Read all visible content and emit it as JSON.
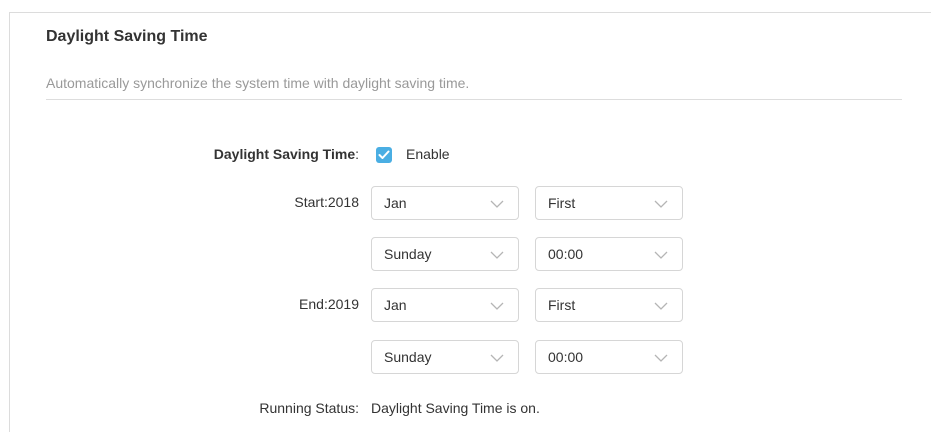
{
  "section": {
    "title": "Daylight Saving Time",
    "description": "Automatically synchronize the system time with daylight saving time."
  },
  "dst": {
    "label": "Daylight Saving Time",
    "colon": ":",
    "enabled": true,
    "enable_label": "Enable"
  },
  "start": {
    "label": "Start:2018",
    "month": "Jan",
    "week": "First",
    "day": "Sunday",
    "time": "00:00"
  },
  "end": {
    "label": "End:2019",
    "month": "Jan",
    "week": "First",
    "day": "Sunday",
    "time": "00:00"
  },
  "status": {
    "label": "Running Status:",
    "value": "Daylight Saving Time is on."
  },
  "colors": {
    "accent": "#4aaee3",
    "muted_text": "#999999",
    "text": "#333333",
    "border": "#d6d6d6"
  },
  "icons": {
    "checkbox": "checkmark-icon",
    "select_arrow": "chevron-down-icon"
  }
}
